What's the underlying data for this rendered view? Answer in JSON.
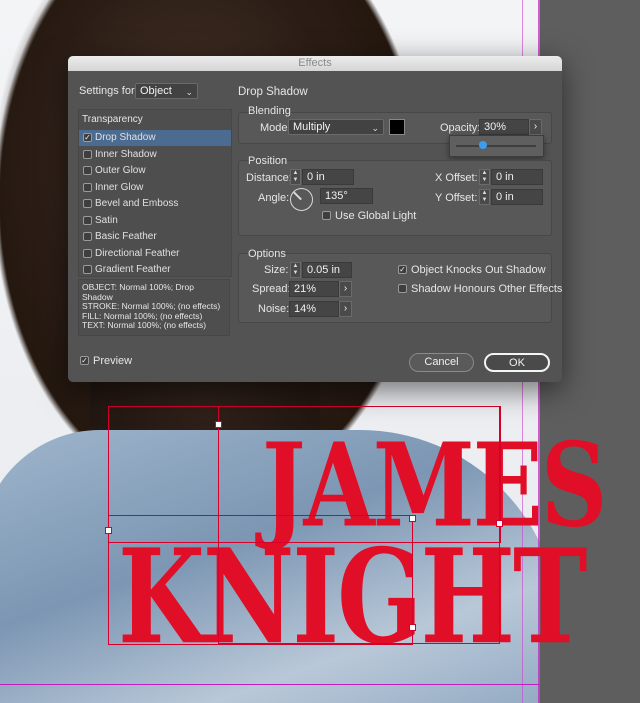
{
  "dialog": {
    "title": "Effects",
    "settings_for_label": "Settings for:",
    "settings_for_value": "Object",
    "section_title": "Drop Shadow",
    "transparency_label": "Transparency",
    "effects": [
      {
        "label": "Drop Shadow",
        "checked": true,
        "selected": true
      },
      {
        "label": "Inner Shadow",
        "checked": false,
        "selected": false
      },
      {
        "label": "Outer Glow",
        "checked": false,
        "selected": false
      },
      {
        "label": "Inner Glow",
        "checked": false,
        "selected": false
      },
      {
        "label": "Bevel and Emboss",
        "checked": false,
        "selected": false
      },
      {
        "label": "Satin",
        "checked": false,
        "selected": false
      },
      {
        "label": "Basic Feather",
        "checked": false,
        "selected": false
      },
      {
        "label": "Directional Feather",
        "checked": false,
        "selected": false
      },
      {
        "label": "Gradient Feather",
        "checked": false,
        "selected": false
      }
    ],
    "summary": [
      "OBJECT: Normal 100%; Drop Shadow",
      "STROKE: Normal 100%; (no effects)",
      "FILL: Normal 100%; (no effects)",
      "TEXT: Normal 100%; (no effects)"
    ],
    "blending": {
      "heading": "Blending",
      "mode_label": "Mode:",
      "mode_value": "Multiply",
      "swatch_color": "#000000",
      "opacity_label": "Opacity:",
      "opacity_value": "30%",
      "opacity_level": 0.3
    },
    "position": {
      "heading": "Position",
      "distance_label": "Distance:",
      "distance_value": "0 in",
      "angle_label": "Angle:",
      "angle_value": "135°",
      "use_global_light_label": "Use Global Light",
      "use_global_light": false,
      "x_offset_label": "X Offset:",
      "x_offset_value": "0 in",
      "y_offset_label": "Y Offset:",
      "y_offset_value": "0 in"
    },
    "options": {
      "heading": "Options",
      "size_label": "Size:",
      "size_value": "0.05 in",
      "spread_label": "Spread:",
      "spread_value": "21%",
      "noise_label": "Noise:",
      "noise_value": "14%",
      "knocks_out_label": "Object Knocks Out Shadow",
      "knocks_out": true,
      "honours_label": "Shadow Honours Other Effects",
      "honours": false
    },
    "preview_label": "Preview",
    "preview": true,
    "cancel_label": "Cancel",
    "ok_label": "OK"
  },
  "cover": {
    "line1": "JAMES",
    "line2": "KNIGHT",
    "text_color": "#e00e26"
  }
}
